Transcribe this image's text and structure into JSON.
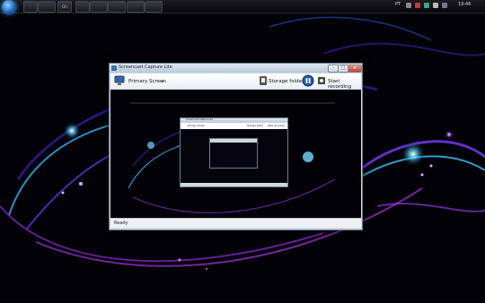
{
  "taskbar": {
    "buttons": [
      "",
      "",
      "Gh",
      "",
      "",
      "",
      ""
    ],
    "language": "PT",
    "clock": "19:46"
  },
  "window": {
    "title": "Screencast Capture Lite",
    "source_label": "Primary Screen",
    "storage_label": "Storage folder",
    "record_label": "Start recording",
    "status": "Ready",
    "controls": {
      "minimize": "–",
      "maximize": "□",
      "close": "×"
    }
  },
  "nested": {
    "title": "Screencast Capture Lite",
    "source_label": "Primary Screen",
    "storage_label": "Storage folder",
    "record_label": "Start recording"
  },
  "colors": {
    "accent": "#3aa0ff",
    "swirl_cyan": "#4fd6ff",
    "swirl_purple": "#a53cff"
  }
}
